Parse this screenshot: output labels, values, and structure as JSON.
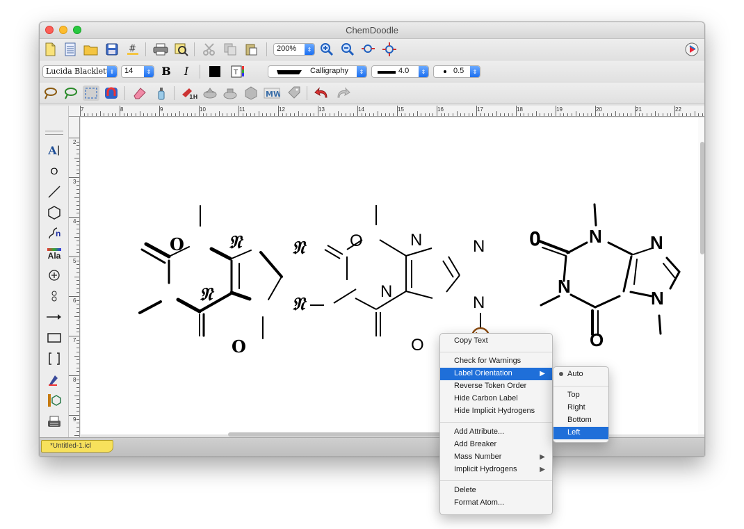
{
  "window": {
    "title": "ChemDoodle"
  },
  "toolbar": {
    "zoom": "200%",
    "font_name": "Lucida Blackletter",
    "font_size": "14",
    "bold_label": "B",
    "italic_label": "I",
    "line_style": "Calligraphy",
    "line_width": "4.0",
    "dot_size": "0.5"
  },
  "ruler": {
    "top_labels": [
      "7",
      "8",
      "9",
      "10",
      "11",
      "12",
      "13",
      "14",
      "15",
      "16",
      "17",
      "18",
      "19",
      "20",
      "21",
      "22"
    ],
    "left_labels": [
      "2",
      "3",
      "4",
      "5",
      "6",
      "7",
      "8",
      "9"
    ]
  },
  "side_tools": {
    "text_tool_label": "A",
    "atom_label": "O",
    "chain_label": "n",
    "amino_label": "Ala"
  },
  "molecules": {
    "left": {
      "atoms": [
        "O",
        "𝔑",
        "𝔑",
        "𝔑",
        "𝔑",
        "O"
      ]
    },
    "middle": {
      "atoms": [
        "O",
        "N",
        "N",
        "N",
        "N",
        "O"
      ]
    },
    "right": {
      "atoms": [
        "O",
        "N",
        "N",
        "N",
        "N",
        "O"
      ]
    }
  },
  "document_tab": {
    "label": "*Untitled-1.icl"
  },
  "context_menu": {
    "items": [
      {
        "label": "Copy Text"
      },
      {
        "label": "Check for Warnings"
      },
      {
        "label": "Label Orientation",
        "submenu": true,
        "selected": true
      },
      {
        "label": "Reverse Token Order"
      },
      {
        "label": "Hide Carbon Label"
      },
      {
        "label": "Hide Implicit Hydrogens"
      },
      {
        "label": "Add Attribute..."
      },
      {
        "label": "Add Breaker"
      },
      {
        "label": "Mass Number",
        "submenu": true
      },
      {
        "label": "Implicit Hydrogens",
        "submenu": true
      },
      {
        "label": "Delete"
      },
      {
        "label": "Format Atom..."
      }
    ]
  },
  "orientation_submenu": {
    "items": [
      {
        "label": "Auto",
        "checked": true
      },
      {
        "label": "Top"
      },
      {
        "label": "Right"
      },
      {
        "label": "Bottom"
      },
      {
        "label": "Left",
        "selected": true
      }
    ]
  },
  "colors": {
    "menu_highlight": "#1f6fd9",
    "doc_tab": "#f7e15c"
  }
}
